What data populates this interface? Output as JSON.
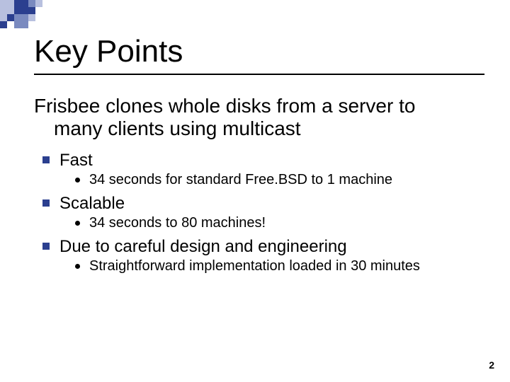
{
  "title": "Key Points",
  "lead_line1": "Frisbee clones whole disks from a server to",
  "lead_line2": "many clients using multicast",
  "bullets": [
    {
      "label": "Fast",
      "sub": [
        "34 seconds for standard Free.BSD to 1 machine"
      ]
    },
    {
      "label": "Scalable",
      "sub": [
        "34 seconds to 80 machines!"
      ]
    },
    {
      "label": "Due to careful design and engineering",
      "sub": [
        "Straightforward implementation loaded in 30 minutes"
      ]
    }
  ],
  "page_number": "2"
}
